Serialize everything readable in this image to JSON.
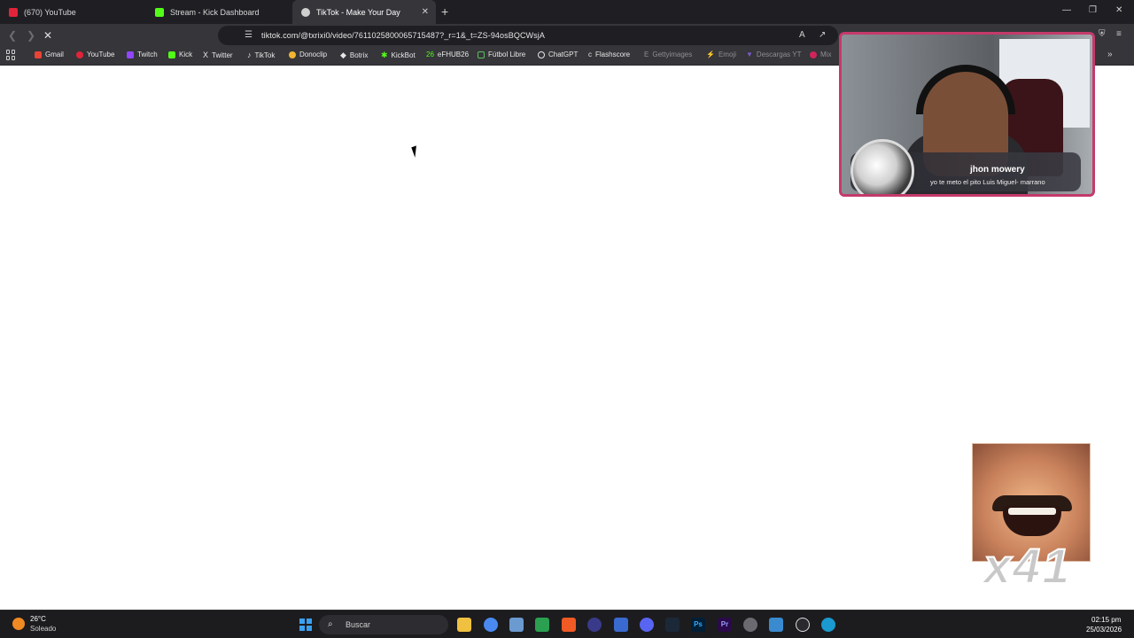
{
  "browser": {
    "tabs": [
      {
        "label": "(670) YouTube",
        "favicon": "youtube-icon",
        "color": "#e0243a"
      },
      {
        "label": "Stream - Kick Dashboard",
        "favicon": "kick-icon",
        "color": "#53fc18"
      },
      {
        "label": "TikTok - Make Your Day",
        "favicon": "tiktok-icon",
        "color": "#d0d0d0"
      }
    ],
    "new_tab_label": "+",
    "url": "tiktok.com/@txrixi0/video/7611025800065715487?_r=1&_t=ZS-94osBQCWsjA",
    "bookmarks": [
      {
        "label": "Gmail",
        "color": "#ea4335"
      },
      {
        "label": "YouTube",
        "color": "#e0243a"
      },
      {
        "label": "Twitch",
        "color": "#9146ff"
      },
      {
        "label": "Kick",
        "color": "#53fc18"
      },
      {
        "label": "Twitter",
        "color": "#e6e6e6"
      },
      {
        "label": "TikTok",
        "color": "#e6e6e6"
      },
      {
        "label": "Donoclip",
        "color": "#f0b430"
      },
      {
        "label": "Botrix",
        "color": "#e6e6e6"
      },
      {
        "label": "KickBot",
        "color": "#53fc18"
      },
      {
        "label": "eFHUB26",
        "color": "#53fc18"
      },
      {
        "label": "Fútbol Libre",
        "color": "#5cc05c"
      },
      {
        "label": "ChatGPT",
        "color": "#e6e6e6"
      },
      {
        "label": "Flashscore",
        "color": "#e6e6e6"
      },
      {
        "label": "Gettyimages",
        "color": "#e6e6e6"
      },
      {
        "label": "Emoji",
        "color": "#d03a6a"
      },
      {
        "label": "Descargas YT",
        "color": "#7a5ad0"
      },
      {
        "label": "Mix",
        "color": "#d0245a"
      }
    ]
  },
  "overlay": {
    "alert_name": "jhon mowery",
    "alert_message": "yo te meto el pito Luis Miguel- marrano",
    "meme_count": "x41",
    "cam_border_color": "#c43a6a"
  },
  "taskbar": {
    "weather_temp": "26°C",
    "weather_status": "Soleado",
    "search_placeholder": "Buscar",
    "time": "02:15 pm",
    "date": "25/03/2026",
    "apps": [
      {
        "name": "file-explorer-icon",
        "label": "",
        "color": "#f0c040"
      },
      {
        "name": "chrome-icon",
        "label": "",
        "color": "#4a8af0"
      },
      {
        "name": "vpn-icon",
        "label": "",
        "color": "#6a9ad0"
      },
      {
        "name": "sheets-icon",
        "label": "",
        "color": "#2aa050"
      },
      {
        "name": "brave-icon",
        "label": "",
        "color": "#f05a24"
      },
      {
        "name": "media-icon",
        "label": "",
        "color": "#3a3a8a"
      },
      {
        "name": "calculator-icon",
        "label": "",
        "color": "#3a6ad0"
      },
      {
        "name": "discord-icon",
        "label": "",
        "color": "#5865f2"
      },
      {
        "name": "steam-icon",
        "label": "",
        "color": "#1b2838"
      },
      {
        "name": "photoshop-icon",
        "label": "Ps",
        "color": "#001e36"
      },
      {
        "name": "premiere-icon",
        "label": "Pr",
        "color": "#2a0a4a"
      },
      {
        "name": "settings-icon",
        "label": "",
        "color": "#6a6a70"
      },
      {
        "name": "notepad-icon",
        "label": "",
        "color": "#3a8ad0"
      },
      {
        "name": "player-icon",
        "label": "",
        "color": "#2a2a2e"
      },
      {
        "name": "edge-icon",
        "label": "",
        "color": "#1a9ad0"
      }
    ]
  }
}
